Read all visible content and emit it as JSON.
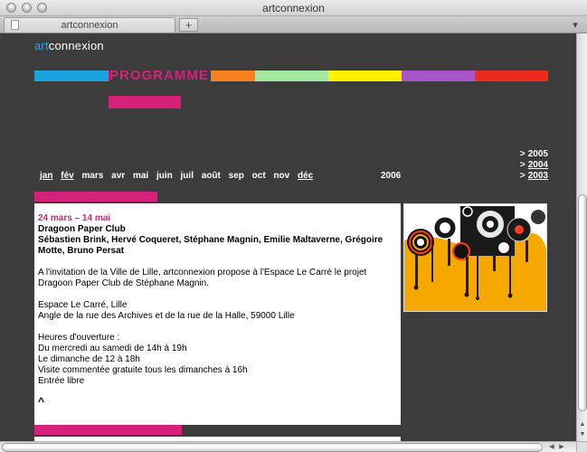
{
  "window": {
    "title": "artconnexion",
    "tab_label": "artconnexion",
    "new_tab_symbol": "+",
    "menu_symbol": "▾"
  },
  "site": {
    "logo_prefix": "art",
    "logo_suffix": "connexion",
    "section_label": "PROGRAMME",
    "colors": {
      "blue": "#1aa3dc",
      "magenta": "#d6217a",
      "orange": "#f7801f",
      "green": "#a6e8a0",
      "yellow": "#fff200",
      "purple": "#a755c8",
      "red": "#ee2a1b"
    }
  },
  "years": [
    {
      "prefix": ">",
      "label": "2005",
      "link": false
    },
    {
      "prefix": ">",
      "label": "2004",
      "link": true
    },
    {
      "prefix": ">",
      "label": "2003",
      "link": true
    }
  ],
  "months": [
    {
      "label": "jan",
      "link": true
    },
    {
      "label": "fév",
      "link": true
    },
    {
      "label": "mars",
      "link": false
    },
    {
      "label": "avr",
      "link": false
    },
    {
      "label": "mai",
      "link": false
    },
    {
      "label": "juin",
      "link": false
    },
    {
      "label": "juil",
      "link": false
    },
    {
      "label": "août",
      "link": false
    },
    {
      "label": "sep",
      "link": false
    },
    {
      "label": "oct",
      "link": false
    },
    {
      "label": "nov",
      "link": false
    },
    {
      "label": "déc",
      "link": true
    }
  ],
  "current_year": "2006",
  "article": {
    "dates": "24 mars – 14 mai",
    "title": "Dragoon Paper Club",
    "artists": "Sébastien Brink, Hervé Coqueret, Stéphane Magnin, Emilie Maltaverne, Grégoire Motte, Bruno Persat",
    "intro": "A l'invitation de la Ville de Lille, artconnexion propose à l'Espace Le Carré le projet Dragoon Paper Club de Stéphane Magnin.",
    "venue_line1": "Espace Le Carré, Lille",
    "venue_line2": "Angle de la rue des Archives et de la rue de la Halle, 59000 Lille",
    "hours_heading": "Heures d'ouverture :",
    "hours_line1": "Du mercredi au samedi de 14h à 19h",
    "hours_line2": "Le dimanche de 12 à 18h",
    "hours_line3": "Visite commentée gratuite tous les dimanches à 16h",
    "hours_line4": "Entrée libre",
    "back_to_top": "^"
  }
}
